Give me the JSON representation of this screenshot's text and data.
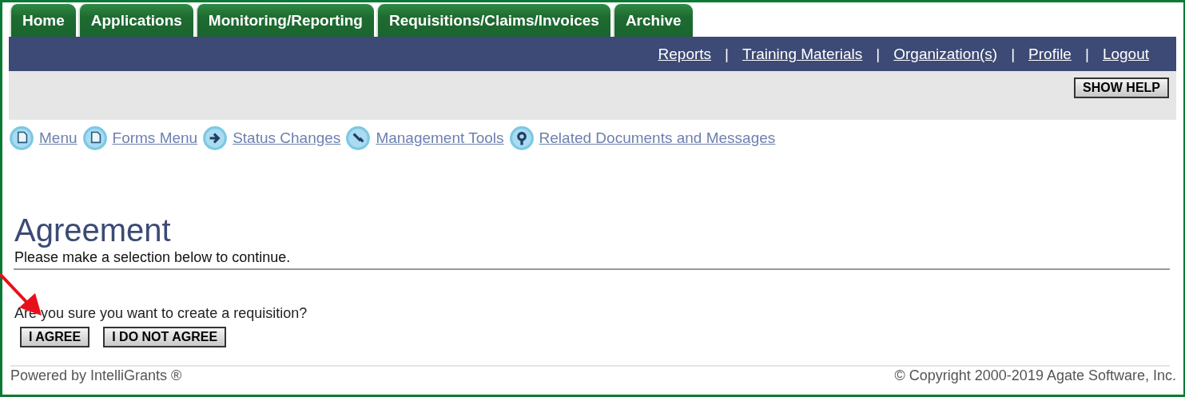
{
  "tabs": [
    {
      "label": "Home"
    },
    {
      "label": "Applications"
    },
    {
      "label": "Monitoring/Reporting"
    },
    {
      "label": "Requisitions/Claims/Invoices"
    },
    {
      "label": "Archive"
    }
  ],
  "top_links": [
    {
      "kind": "link",
      "text": "Reports"
    },
    {
      "kind": "separator",
      "text": "|"
    },
    {
      "kind": "link",
      "text": "Training Materials"
    },
    {
      "kind": "separator",
      "text": "|"
    },
    {
      "kind": "link",
      "text": "Organization(s)"
    },
    {
      "kind": "separator",
      "text": "|"
    },
    {
      "kind": "link",
      "text": "Profile"
    },
    {
      "kind": "separator",
      "text": "|"
    },
    {
      "kind": "link",
      "text": "Logout"
    }
  ],
  "help_button": "SHOW HELP",
  "nav_links": [
    {
      "kind": "page",
      "label": "Menu"
    },
    {
      "kind": "page",
      "label": "Forms Menu"
    },
    {
      "kind": "arrow",
      "label": "Status Changes"
    },
    {
      "kind": "tools",
      "label": "Management Tools"
    },
    {
      "kind": "search",
      "label": "Related Documents and Messages"
    }
  ],
  "page": {
    "title": "Agreement",
    "subtitle": "Please make a selection below to continue.",
    "question": "Are you sure you want to create a requisition?",
    "buttons": [
      "I AGREE",
      "I DO NOT AGREE"
    ]
  },
  "footer": {
    "left": "Powered by IntelliGrants ®",
    "right": "© Copyright 2000-2019 Agate Software, Inc."
  }
}
